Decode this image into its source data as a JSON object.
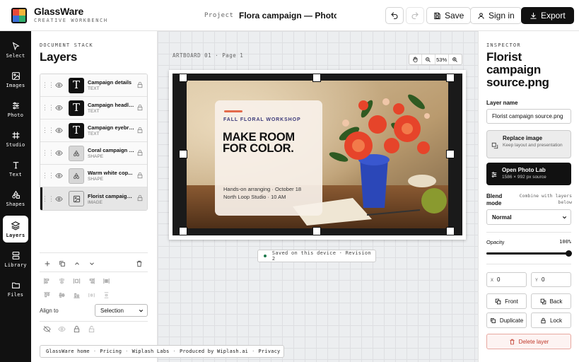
{
  "header": {
    "app_name": "GlassWare",
    "app_subtitle": "CREATIVE WORKBENCH",
    "project_label": "Project",
    "project_title": "Flora campaign — Photo Launch",
    "save_label": "Save",
    "signin_label": "Sign in",
    "export_label": "Export"
  },
  "tools": [
    {
      "label": "Select",
      "icon": "cursor-icon"
    },
    {
      "label": "Images",
      "icon": "image-icon"
    },
    {
      "label": "Photo",
      "icon": "sliders-icon"
    },
    {
      "label": "Studio",
      "icon": "frame-icon"
    },
    {
      "label": "Text",
      "icon": "text-icon"
    },
    {
      "label": "Shapes",
      "icon": "shapes-icon"
    },
    {
      "label": "Layers",
      "icon": "layers-icon",
      "active": true
    },
    {
      "label": "Library",
      "icon": "library-icon"
    },
    {
      "label": "Files",
      "icon": "folder-icon"
    }
  ],
  "layers_panel": {
    "eyebrow": "DOCUMENT STACK",
    "title": "Layers",
    "layers": [
      {
        "name": "Campaign details",
        "type": "TEXT",
        "thumb": "text"
      },
      {
        "name": "Campaign headline",
        "type": "TEXT",
        "thumb": "text"
      },
      {
        "name": "Campaign eyebrow",
        "type": "TEXT",
        "thumb": "text"
      },
      {
        "name": "Coral campaign r...",
        "type": "SHAPE",
        "thumb": "shape"
      },
      {
        "name": "Warm white cop...",
        "type": "SHAPE",
        "thumb": "shape"
      },
      {
        "name": "Florist campaign ...",
        "type": "IMAGE",
        "thumb": "image",
        "selected": true
      }
    ],
    "align_to_label": "Align to",
    "align_to_value": "Selection"
  },
  "canvas": {
    "artboard_label": "ARTBOARD 01 · Page 1",
    "zoom": "53%",
    "promo": {
      "eyebrow": "FALL FLORAL WORKSHOP",
      "headline_1": "MAKE ROOM",
      "headline_2": "FOR COLOR.",
      "detail_1": "Hands-on arranging · October 18",
      "detail_2": "North Loop Studio · 10 AM"
    },
    "status": "Saved on this device · Revision 2"
  },
  "footer": {
    "links": [
      "GlassWare home",
      "Pricing",
      "Wiplash Labs",
      "Produced by Wiplash.ai",
      "Privacy"
    ]
  },
  "inspector": {
    "eyebrow": "INSPECTOR",
    "title": "Florist campaign source.png",
    "layer_name_label": "Layer name",
    "layer_name_value": "Florist campaign source.png",
    "replace_title": "Replace image",
    "replace_sub": "Keep layout and presentation",
    "photolab_title": "Open Photo Lab",
    "photolab_sub": "1586 × 992 px source",
    "blend_label": "Blend mode",
    "blend_hint": "Combine with layers below",
    "blend_value": "Normal",
    "opacity_label": "Opacity",
    "opacity_value": "100%",
    "opacity_fraction": 1.0,
    "x_label": "X",
    "x_value": "0",
    "y_label": "Y",
    "y_value": "0",
    "front_label": "Front",
    "back_label": "Back",
    "duplicate_label": "Duplicate",
    "lock_label": "Lock",
    "delete_label": "Delete layer"
  },
  "colors": {
    "accent": "#111111",
    "danger": "#c0392b",
    "promo_bar": "#e36a4a",
    "eyebrow_purple": "#3c3a7a",
    "saved_dot": "#1f7a4d"
  }
}
